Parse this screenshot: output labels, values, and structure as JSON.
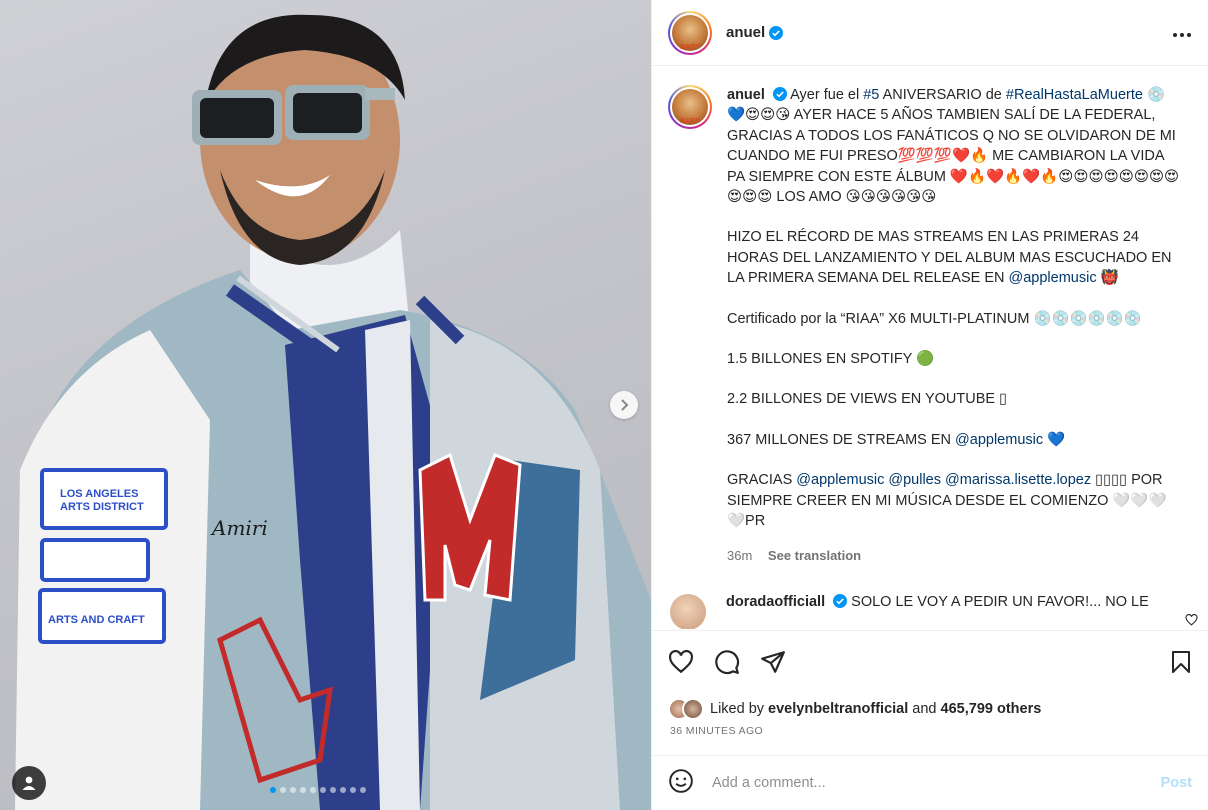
{
  "post": {
    "username": "anuel",
    "avatar_label": "BABY",
    "more_icon": "more-horizontal-icon",
    "image_dots_count": 10,
    "active_dot": 0
  },
  "photo_text": {
    "patch1_line1": "LOS ANGELES",
    "patch1_line2": "ARTS DISTRICT",
    "patch2": "ARTS AND CRAFT",
    "script_logo": "Amiri",
    "letter_m": "M",
    "letter_a": "a"
  },
  "caption": {
    "username": "anuel",
    "lines": [
      "Ayer fue el ",
      "#5",
      " ANIVERSARIO de ",
      "#RealHastaLaMuerte"
    ],
    "p1": "💿💙😍😍😘 AYER HACE 5 AÑOS TAMBIEN SALÍ DE LA FEDERAL, GRACIAS A TODOS LOS FANÁTICOS Q NO SE OLVIDARON DE MI CUANDO ME FUI PRESO💯💯💯❤️🔥 ME CAMBIARON LA VIDA PA SIEMPRE CON ESTE ÁLBUM ❤️🔥❤️🔥❤️🔥😍😍😍😍😍😍😍😍 😍😍😍 LOS AMO 😘😘😘😘😘😘",
    "p2a": "HIZO EL RÉCORD DE MAS STREAMS EN LAS PRIMERAS 24 HORAS DEL LANZAMIENTO Y DEL ALBUM MAS ESCUCHADO EN LA PRIMERA SEMANA DEL RELEASE EN ",
    "p2_link": "@applemusic",
    "p2_end": " 👹",
    "p3": "Certificado por la “RIAA” X6 MULTI-PLATINUM 💿💿💿💿💿💿",
    "p4": "1.5 BILLONES EN SPOTIFY 🟢",
    "p5": "2.2 BILLONES DE VIEWS EN YOUTUBE ▯",
    "p6a": "367 MILLONES DE STREAMS EN ",
    "p6_link": "@applemusic",
    "p6_end": " 💙",
    "p7a": "GRACIAS ",
    "p7_link1": "@applemusic",
    "p7_link2": "@pulles",
    "p7_link3": "@marissa.lisette.lopez",
    "p7_end": " ▯▯▯▯ POR SIEMPRE CREER EN MI MÚSICA DESDE EL COMIENZO 🤍🤍🤍🤍PR",
    "time": "36m",
    "see_translation": "See translation"
  },
  "comment": {
    "username": "doradaofficiall",
    "text": "SOLO LE VOY A PEDIR UN FAVOR!... NO LE"
  },
  "likes": {
    "prefix": "Liked by ",
    "user": "evelynbeltranofficial",
    "middle": " and ",
    "count": "465,799 others"
  },
  "timeago": "36 MINUTES AGO",
  "add_comment": {
    "placeholder": "Add a comment...",
    "post_label": "Post"
  },
  "colors": {
    "link": "#00376b",
    "verified": "#0095f6",
    "post_disabled": "#b2dffc"
  }
}
